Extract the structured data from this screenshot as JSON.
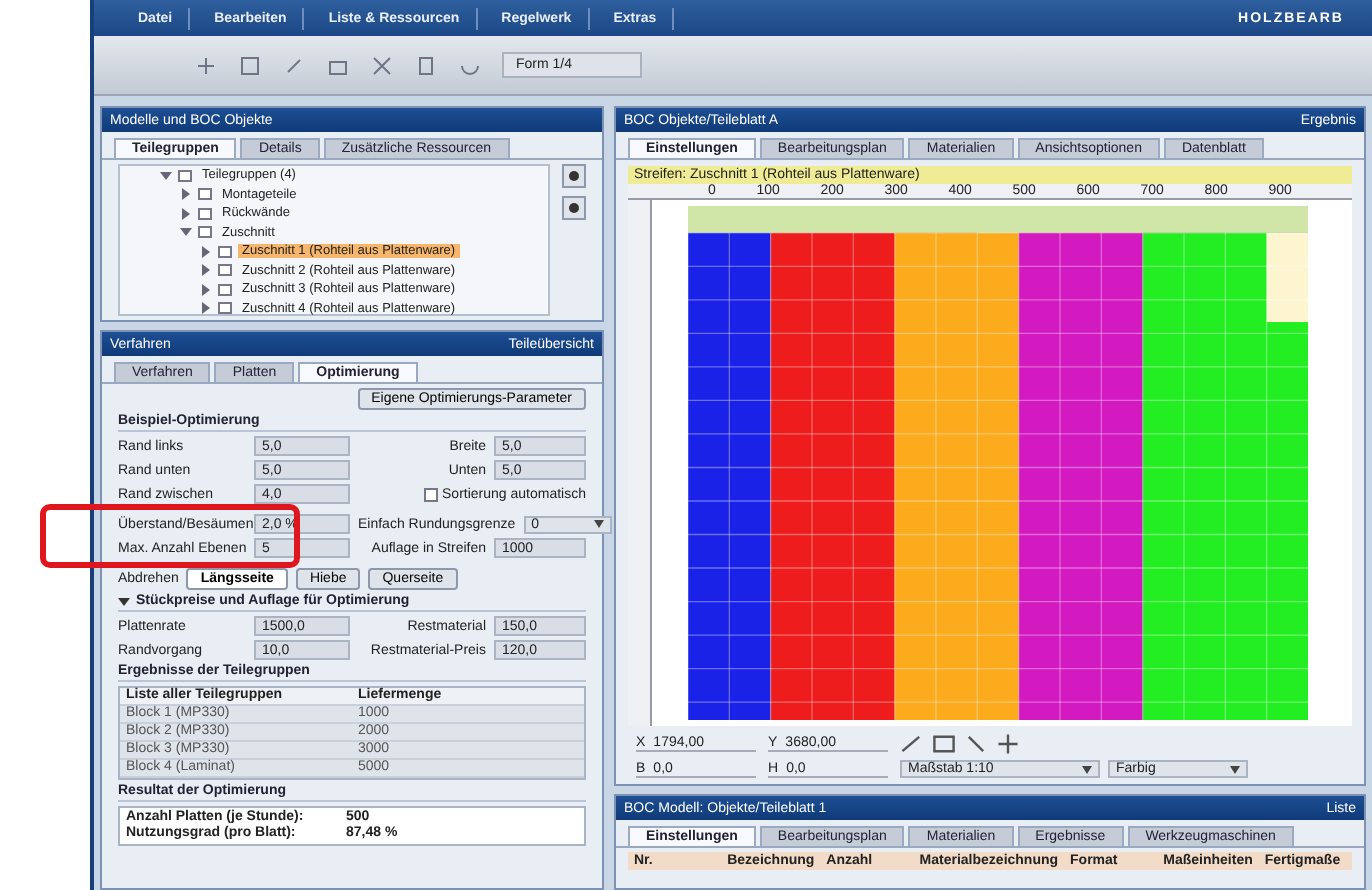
{
  "menu": [
    "Datei",
    "Bearbeiten",
    "Liste & Ressourcen",
    "Regelwerk",
    "Extras"
  ],
  "logo": "HOLZBEARB",
  "toolbar": {
    "zoom": "Form 1/4"
  },
  "models_panel": {
    "title": "Modelle und BOC Objekte",
    "tabs": [
      {
        "label": "Teilegruppen",
        "selected": true
      },
      {
        "label": "Details",
        "selected": false
      },
      {
        "label": "Zusätzliche Ressourcen",
        "selected": false
      }
    ],
    "tree": [
      {
        "label": "Teilegruppen (4)",
        "expanded": true,
        "selected": false,
        "children": [
          {
            "label": "Montageteile",
            "expanded": false,
            "selected": false
          },
          {
            "label": "Rückwände",
            "expanded": false,
            "selected": false
          },
          {
            "label": "Zuschnitt",
            "expanded": true,
            "selected": false,
            "children": [
              {
                "label": "Zuschnitt 1 (Rohteil aus Plattenware)",
                "expanded": false,
                "selected": true
              },
              {
                "label": "Zuschnitt 2 (Rohteil aus Plattenware)",
                "expanded": false,
                "selected": false
              },
              {
                "label": "Zuschnitt 3 (Rohteil aus Plattenware)",
                "expanded": false,
                "selected": false
              },
              {
                "label": "Zuschnitt 4 (Rohteil aus Plattenware)",
                "expanded": false,
                "selected": false
              }
            ]
          }
        ]
      }
    ]
  },
  "settings_panel": {
    "title": "Verfahren",
    "title_right": "Teileübersicht",
    "tabs": [
      {
        "label": "Verfahren",
        "selected": false
      },
      {
        "label": "Platten",
        "selected": false
      },
      {
        "label": "Optimierung",
        "selected": true
      }
    ],
    "own_params": "Eigene Optimierungs-Parameter",
    "section_1": "Beispiel-Optimierung",
    "fields": [
      {
        "label": "Rand links",
        "value": "5,0",
        "label_2": "Breite",
        "value_2": "5,0",
        "highlighted": false
      },
      {
        "label": "Rand unten",
        "value": "5,0",
        "label_2": "Unten",
        "value_2": "5,0",
        "highlighted": false
      },
      {
        "label": "Rand zwischen",
        "value": "4,0",
        "checkbox": "Sortierung automatisch",
        "checked": false,
        "highlighted": false
      },
      {
        "label": "Überstand/Besäumen",
        "value": "2,0 %",
        "label_2": "Einfach Rundungsgrenze",
        "select_2": "0",
        "highlighted": true
      },
      {
        "label": "Max. Anzahl Ebenen",
        "value": "5",
        "label_2": "Auflage in Streifen",
        "value_2": "1000",
        "highlighted": true
      }
    ],
    "turn_label": "Abdrehen",
    "turn_options": [
      {
        "label": "Längsseite",
        "selected": true
      },
      {
        "label": "Hiebe",
        "selected": false
      },
      {
        "label": "Querseite",
        "selected": false
      }
    ],
    "section_2": "Stückpreise und Auflage für Optimierung",
    "section_2_expanded": true,
    "prices": [
      {
        "label": "Plattenrate",
        "value": "1500,0",
        "label_2": "Restmaterial",
        "value_2": "150,0"
      },
      {
        "label": "Randvorgang",
        "value": "10,0",
        "label_2": "Restmaterial-Preis",
        "value_2": "120,0"
      }
    ],
    "section_3": "Ergebnisse der Teilegruppen",
    "groups_table": {
      "columns": [
        "Liste aller Teilegruppen",
        "Liefermenge"
      ],
      "rows": [
        [
          "Block 1 (MP330)",
          "1000"
        ],
        [
          "Block 2 (MP330)",
          "2000"
        ],
        [
          "Block 3 (MP330)",
          "3000"
        ],
        [
          "Block 4 (Laminat)",
          "5000"
        ]
      ]
    },
    "section_4": "Resultat der Optimierung",
    "results": [
      {
        "label": "Anzahl Platten (je Stunde):",
        "value": "500"
      },
      {
        "label": "Nutzungsgrad (pro Blatt):",
        "value": "87,48 %"
      }
    ]
  },
  "layout_panel": {
    "title": "BOC Objekte/Teileblatt A",
    "title_right": "Ergebnis",
    "tabs": [
      {
        "label": "Einstellungen",
        "selected": true
      },
      {
        "label": "Bearbeitungsplan",
        "selected": false
      },
      {
        "label": "Materialien",
        "selected": false
      },
      {
        "label": "Ansichtsoptionen",
        "selected": false
      },
      {
        "label": "Datenblatt",
        "selected": false
      }
    ],
    "info": "Streifen: Zuschnitt 1 (Rohteil aus Plattenware)",
    "ruler": [
      "0",
      "100",
      "200",
      "300",
      "400",
      "500",
      "600",
      "700",
      "800",
      "900"
    ],
    "coords": [
      {
        "label": "X",
        "value": "1794,00"
      },
      {
        "label": "Y",
        "value": "3680,00"
      },
      {
        "label": "B",
        "value": "0,0"
      },
      {
        "label": "H",
        "value": "0,0"
      }
    ],
    "scale": "Maßstab 1:10",
    "mode": "Farbig"
  },
  "parts_panel": {
    "title": "BOC Modell: Objekte/Teileblatt 1",
    "title_right": "Liste",
    "tabs": [
      {
        "label": "Einstellungen",
        "selected": true
      },
      {
        "label": "Bearbeitungsplan",
        "selected": false
      },
      {
        "label": "Materialien",
        "selected": false
      },
      {
        "label": "Ergebnisse",
        "selected": false
      },
      {
        "label": "Werkzeugmaschinen",
        "selected": false
      }
    ],
    "columns": [
      "Nr.",
      "Bezeichnung",
      "Anzahl",
      "Materialbezeichnung",
      "Format",
      "Maßeinheiten",
      "Fertigmaße"
    ]
  }
}
